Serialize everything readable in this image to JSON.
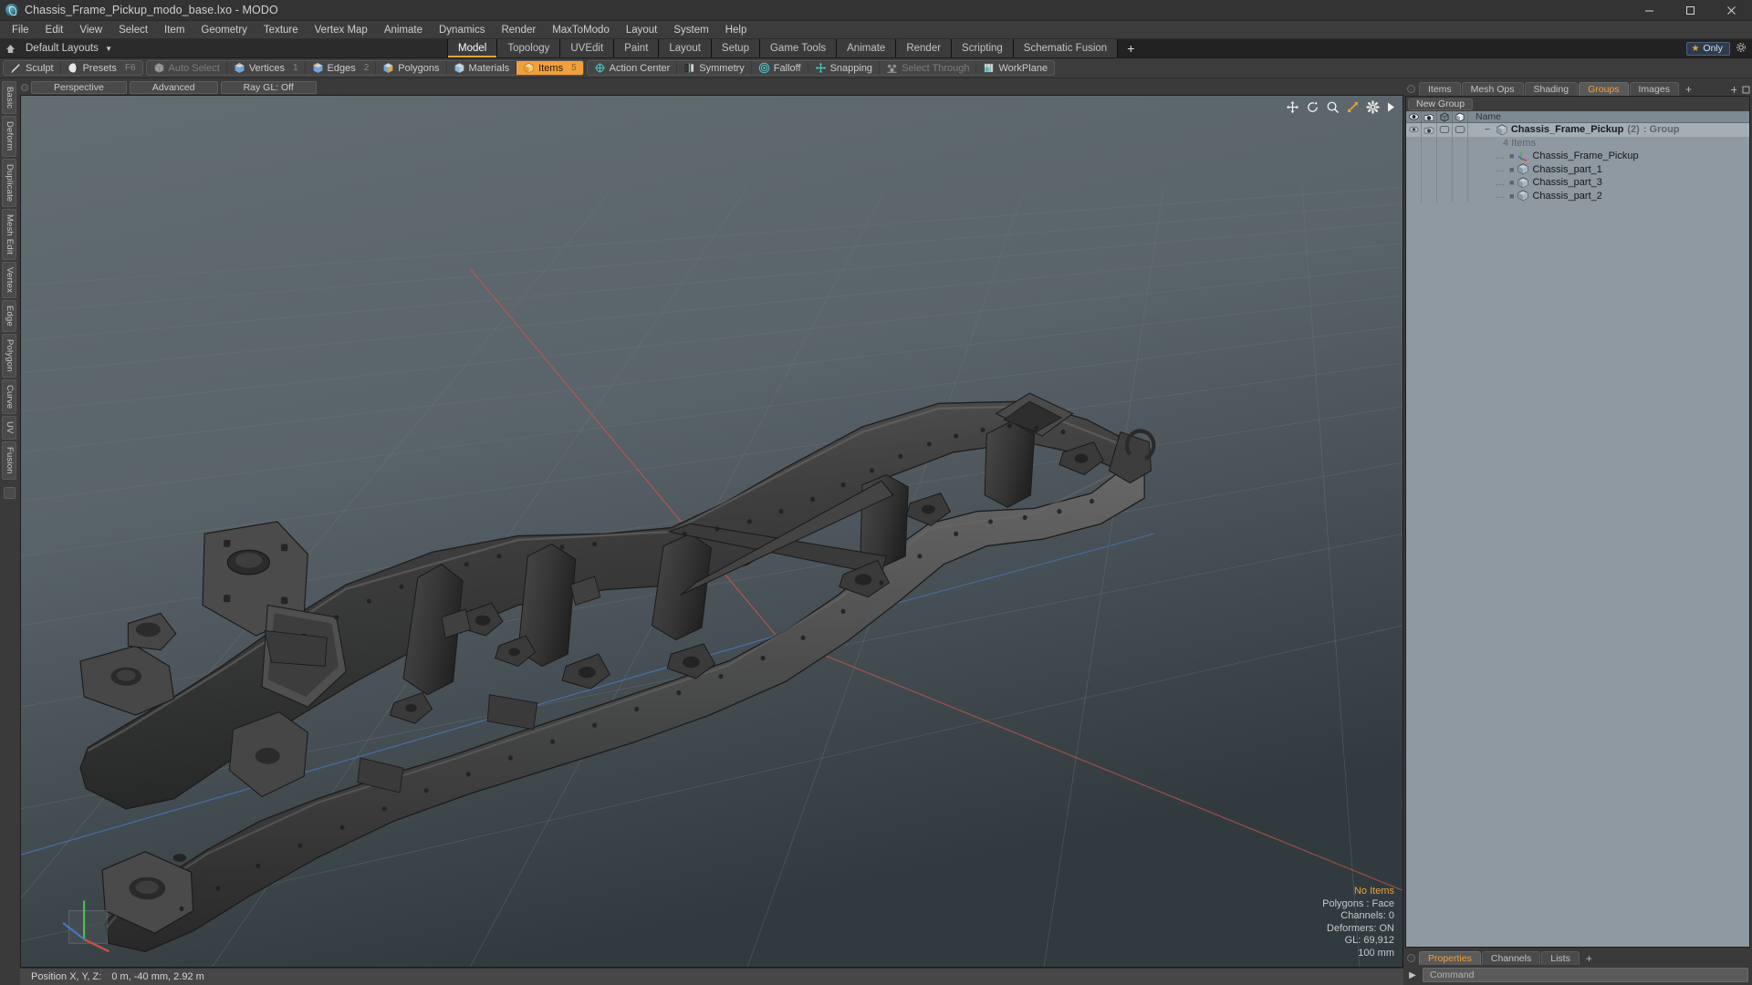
{
  "window": {
    "title": "Chassis_Frame_Pickup_modo_base.lxo - MODO",
    "app_icon": "modo-logo-icon",
    "minimize": "minimize-icon",
    "maximize": "maximize-icon",
    "close": "close-icon"
  },
  "menubar": {
    "items": [
      "File",
      "Edit",
      "View",
      "Select",
      "Item",
      "Geometry",
      "Texture",
      "Vertex Map",
      "Animate",
      "Dynamics",
      "Render",
      "MaxToModo",
      "Layout",
      "System",
      "Help"
    ]
  },
  "layoutbar": {
    "home_icon": "home-icon",
    "layouts_label": "Default Layouts",
    "tabs": [
      {
        "label": "Model",
        "active": true
      },
      {
        "label": "Topology",
        "active": false
      },
      {
        "label": "UVEdit",
        "active": false
      },
      {
        "label": "Paint",
        "active": false
      },
      {
        "label": "Layout",
        "active": false
      },
      {
        "label": "Setup",
        "active": false
      },
      {
        "label": "Game Tools",
        "active": false
      },
      {
        "label": "Animate",
        "active": false
      },
      {
        "label": "Render",
        "active": false
      },
      {
        "label": "Scripting",
        "active": false
      },
      {
        "label": "Schematic Fusion",
        "active": false
      }
    ],
    "add_tab": "+",
    "only_button": {
      "label": "Only",
      "icon": "star-icon"
    },
    "config_icon": "gear-icon"
  },
  "modebar": {
    "groups": [
      {
        "buttons": [
          {
            "label": "Sculpt",
            "icon": "sculpt-brush-icon",
            "key": "",
            "state": "normal"
          },
          {
            "label": "Presets",
            "icon": "preset-sphere-icon",
            "key": "F6",
            "state": "normal"
          }
        ]
      },
      {
        "buttons": [
          {
            "label": "Auto Select",
            "icon": "cube-grey-icon",
            "key": "",
            "state": "dim"
          },
          {
            "label": "Vertices",
            "icon": "cube-vertices-icon",
            "key": "1",
            "state": "normal"
          },
          {
            "label": "Edges",
            "icon": "cube-edges-icon",
            "key": "2",
            "state": "normal"
          },
          {
            "label": "Polygons",
            "icon": "cube-polygons-icon",
            "key": "",
            "state": "normal"
          },
          {
            "label": "Materials",
            "icon": "cube-materials-icon",
            "key": "",
            "state": "normal"
          },
          {
            "label": "Items",
            "icon": "cube-items-icon",
            "key": "5",
            "state": "selected"
          }
        ]
      },
      {
        "buttons": [
          {
            "label": "Action Center",
            "icon": "action-center-icon",
            "key": "",
            "state": "normal"
          },
          {
            "label": "Symmetry",
            "icon": "symmetry-icon",
            "key": "",
            "state": "normal"
          },
          {
            "label": "Falloff",
            "icon": "falloff-icon",
            "key": "",
            "state": "normal"
          },
          {
            "label": "Snapping",
            "icon": "snapping-icon",
            "key": "",
            "state": "normal"
          },
          {
            "label": "Select Through",
            "icon": "select-through-icon",
            "key": "",
            "state": "dim"
          },
          {
            "label": "WorkPlane",
            "icon": "workplane-icon",
            "key": "",
            "state": "normal"
          }
        ]
      }
    ]
  },
  "left_tool_tabs": {
    "items": [
      "Basic",
      "Deform",
      "Duplicate",
      "Mesh Edit",
      "Vertex",
      "Edge",
      "Polygon",
      "Curve",
      "UV",
      "Fusion"
    ]
  },
  "viewport": {
    "header": {
      "dot": "viewport-menu-dot",
      "tabs": [
        {
          "label": "Perspective"
        },
        {
          "label": "Advanced"
        },
        {
          "label": "Ray GL: Off"
        }
      ]
    },
    "nav_icons": [
      "pan-icon",
      "rotate-icon",
      "zoom-icon",
      "fit-icon",
      "settings-gear-icon",
      "expand-arrow-icon"
    ],
    "stats": {
      "selection": "No Items",
      "polygons": "Polygons : Face",
      "channels": "Channels: 0",
      "deformers": "Deformers: ON",
      "gl": "GL: 69,912",
      "grid": "100 mm"
    }
  },
  "statusbar": {
    "position_label": "Position X, Y, Z:",
    "position_value": "0 m, -40 mm, 2.92 m"
  },
  "right_panel": {
    "top_tabs": [
      {
        "label": "Items",
        "active": false
      },
      {
        "label": "Mesh Ops",
        "active": false
      },
      {
        "label": "Shading",
        "active": false
      },
      {
        "label": "Groups",
        "active": true
      },
      {
        "label": "Images",
        "active": false
      }
    ],
    "add_tab": "+",
    "new_group_button": "New Group",
    "tree_columns": [
      "visible-eye-icon",
      "render-camera-icon",
      "wireframe-cube-icon",
      "shaded-cube-icon"
    ],
    "name_column_header": "Name",
    "tree": [
      {
        "level": 0,
        "name": "Chassis_Frame_Pickup",
        "count": "(2)",
        "suffix": ": Group",
        "icon": "group-cube-icon",
        "bold": true,
        "selected": true
      },
      {
        "level": 1,
        "name": "4 Items",
        "count": "",
        "suffix": "",
        "icon": "",
        "bold": false,
        "selected": false
      },
      {
        "level": 1,
        "name": "Chassis_Frame_Pickup",
        "count": "",
        "suffix": "",
        "icon": "locator-axis-icon",
        "bold": false,
        "selected": false
      },
      {
        "level": 1,
        "name": "Chassis_part_1",
        "count": "",
        "suffix": "",
        "icon": "mesh-cube-icon",
        "bold": false,
        "selected": false
      },
      {
        "level": 1,
        "name": "Chassis_part_3",
        "count": "",
        "suffix": "",
        "icon": "mesh-cube-icon",
        "bold": false,
        "selected": false
      },
      {
        "level": 1,
        "name": "Chassis_part_2",
        "count": "",
        "suffix": "",
        "icon": "mesh-cube-icon",
        "bold": false,
        "selected": false
      }
    ],
    "bottom_tabs": [
      {
        "label": "Properties",
        "active": true
      },
      {
        "label": "Channels",
        "active": false
      },
      {
        "label": "Lists",
        "active": false
      }
    ],
    "bottom_add_tab": "+"
  },
  "command_bar": {
    "arrow": "chevron-right-icon",
    "placeholder": "Command"
  },
  "colors": {
    "accent": "#f0a03c",
    "viewport_bg": "#5b6569",
    "panel_bg": "#8e99a1",
    "chrome": "#3c3c3c",
    "axis_x": "#b85c52",
    "axis_z": "#4a6fa5"
  }
}
